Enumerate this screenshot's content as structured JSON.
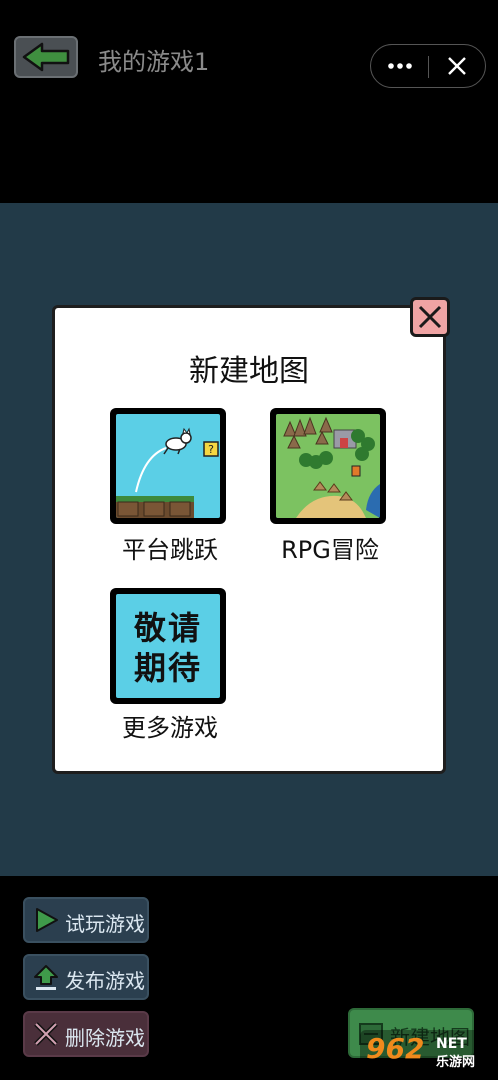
{
  "header": {
    "title": "我的游戏1",
    "back_icon": "arrow-left-icon",
    "more_icon": "more-dots-icon",
    "close_icon": "close-icon"
  },
  "dialog": {
    "title": "新建地图",
    "close_icon": "close-x-icon",
    "options": [
      {
        "label": "平台跳跃",
        "thumbnail": "platformer-thumbnail"
      },
      {
        "label": "RPG冒险",
        "thumbnail": "rpg-map-thumbnail"
      },
      {
        "label": "更多游戏",
        "thumbnail_text": [
          "敬请",
          "期待"
        ]
      }
    ]
  },
  "toolbar": {
    "play_label": "试玩游戏",
    "publish_label": "发布游戏",
    "delete_label": "删除游戏",
    "new_map_label": "新建地图"
  },
  "watermark": {
    "text": "962",
    "suffix": "NET",
    "subtitle": "乐游网"
  },
  "colors": {
    "editor_bg": "#223a48",
    "thumb_sky": "#5bcfe6",
    "close_bg": "#f0a4a4",
    "back_arrow": "#3f8f3f",
    "new_map_bg": "#3e8a4b"
  }
}
